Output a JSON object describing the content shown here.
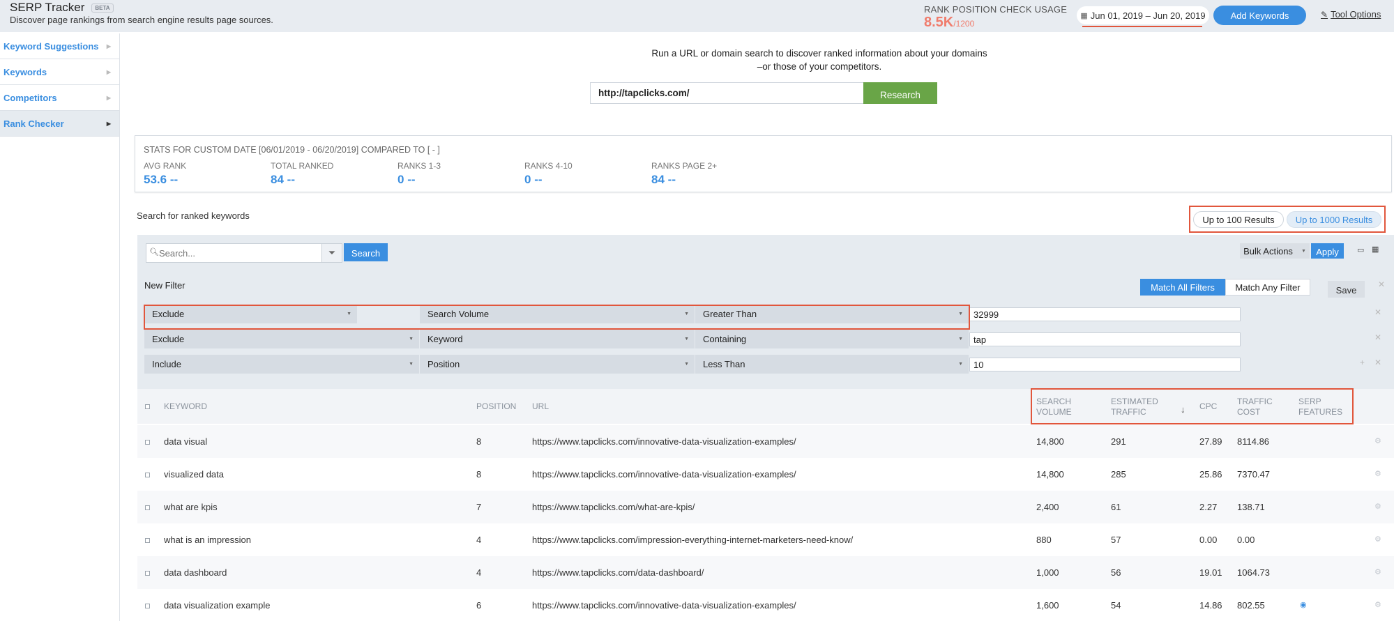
{
  "header": {
    "title": "SERP Tracker",
    "beta": "BETA",
    "subtitle": "Discover page rankings from search engine results page sources.",
    "usage_label": "RANK POSITION CHECK USAGE",
    "usage_value": "8.5K",
    "usage_max": "/1200",
    "date_range": "Jun 01, 2019 – Jun 20, 2019",
    "add_keywords": "Add Keywords",
    "tool_options": "Tool Options"
  },
  "sidebar": {
    "items": [
      {
        "label": "Keyword Suggestions"
      },
      {
        "label": "Keywords"
      },
      {
        "label": "Competitors"
      },
      {
        "label": "Rank Checker"
      }
    ]
  },
  "research": {
    "line1": "Run a URL or domain search to discover ranked information about your domains",
    "line2": "–or those of your competitors.",
    "url": "http://tapclicks.com/",
    "button": "Research"
  },
  "stats": {
    "header": "STATS FOR CUSTOM DATE [06/01/2019 - 06/20/2019] COMPARED TO [ - ]",
    "items": [
      {
        "label": "AVG RANK",
        "value": "53.6",
        "change": "--"
      },
      {
        "label": "TOTAL RANKED",
        "value": "84",
        "change": "--"
      },
      {
        "label": "RANKS 1-3",
        "value": "0",
        "change": "--"
      },
      {
        "label": "RANKS 4-10",
        "value": "0",
        "change": "--"
      },
      {
        "label": "RANKS PAGE 2+",
        "value": "84",
        "change": "--"
      }
    ]
  },
  "search_ranked": {
    "label": "Search for ranked keywords",
    "results_100": "Up to 100 Results",
    "results_1000": "Up to 1000 Results"
  },
  "toolbar": {
    "search_placeholder": "Search...",
    "search_button": "Search",
    "bulk_actions": "Bulk Actions",
    "apply": "Apply",
    "new_filter": "New Filter",
    "match_all": "Match All Filters",
    "match_any": "Match Any Filter",
    "save": "Save"
  },
  "filters": [
    {
      "mode": "Exclude",
      "field": "Search Volume",
      "op": "Greater Than",
      "value": "32999"
    },
    {
      "mode": "Exclude",
      "field": "Keyword",
      "op": "Containing",
      "value": "tap"
    },
    {
      "mode": "Include",
      "field": "Position",
      "op": "Less Than",
      "value": "10"
    }
  ],
  "table": {
    "headers": {
      "keyword": "KEYWORD",
      "position": "POSITION",
      "url": "URL",
      "search_volume_1": "SEARCH",
      "search_volume_2": "VOLUME",
      "est_traffic_1": "ESTIMATED",
      "est_traffic_2": "TRAFFIC",
      "sort_arrow": "↓",
      "cpc": "CPC",
      "traffic_cost_1": "TRAFFIC",
      "traffic_cost_2": "COST",
      "serp_1": "SERP",
      "serp_2": "FEATURES"
    },
    "rows": [
      {
        "keyword": "data visual",
        "position": "8",
        "url": "https://www.tapclicks.com/innovative-data-visualization-examples/",
        "volume": "14,800",
        "traffic": "291",
        "cpc": "27.89",
        "cost": "8114.86"
      },
      {
        "keyword": "visualized data",
        "position": "8",
        "url": "https://www.tapclicks.com/innovative-data-visualization-examples/",
        "volume": "14,800",
        "traffic": "285",
        "cpc": "25.86",
        "cost": "7370.47"
      },
      {
        "keyword": "what are kpis",
        "position": "7",
        "url": "https://www.tapclicks.com/what-are-kpis/",
        "volume": "2,400",
        "traffic": "61",
        "cpc": "2.27",
        "cost": "138.71"
      },
      {
        "keyword": "what is an impression",
        "position": "4",
        "url": "https://www.tapclicks.com/impression-everything-internet-marketers-need-know/",
        "volume": "880",
        "traffic": "57",
        "cpc": "0.00",
        "cost": "0.00"
      },
      {
        "keyword": "data dashboard",
        "position": "4",
        "url": "https://www.tapclicks.com/data-dashboard/",
        "volume": "1,000",
        "traffic": "56",
        "cpc": "19.01",
        "cost": "1064.73"
      },
      {
        "keyword": "data visualization example",
        "position": "6",
        "url": "https://www.tapclicks.com/innovative-data-visualization-examples/",
        "volume": "1,600",
        "traffic": "54",
        "cpc": "14.86",
        "cost": "802.55"
      }
    ]
  }
}
